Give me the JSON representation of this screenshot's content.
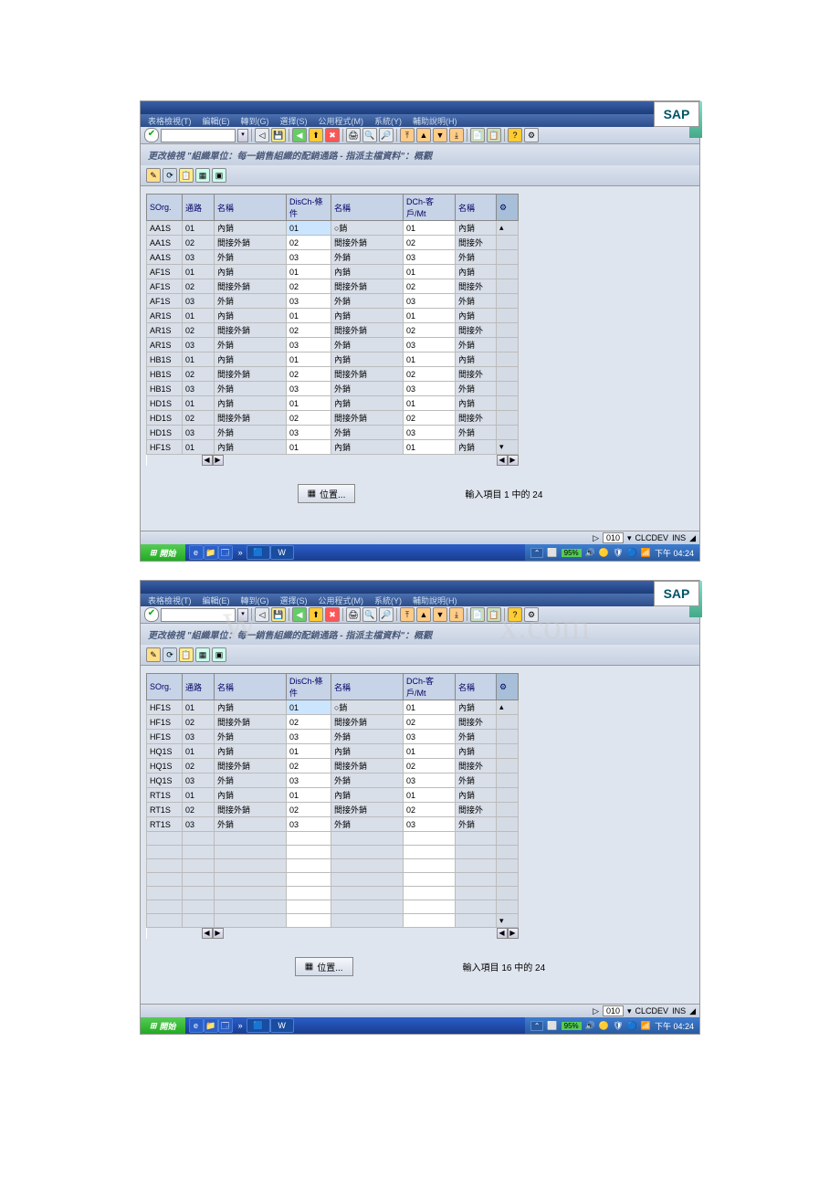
{
  "menu": [
    "表格檢視(T)",
    "編輯(E)",
    "轉到(G)",
    "選擇(S)",
    "公用程式(M)",
    "系統(Y)",
    "輔助說明(H)"
  ],
  "windowTitle": "更改檢視  \"組織單位：每一銷售組織的配銷通路  - 指派主檔資料\"：概觀",
  "positionBtn": "位置...",
  "pageInfo1": "輸入項目 1 中的 24",
  "pageInfo2": "輸入項目 16 中的 24",
  "status": {
    "client": "010",
    "sys": "CLCDEV",
    "mode": "INS"
  },
  "start": "開始",
  "tray": {
    "zoom": "95%",
    "time": "下午 04:24"
  },
  "sap": "SAP",
  "watermark1": "W",
  "watermark2": "x.com",
  "headers": [
    "SOrg.",
    "通路",
    "名稱",
    "DisCh-條件",
    "名稱",
    "DCh-客戶/Mt",
    "名稱"
  ],
  "rows1": [
    [
      "AA1S",
      "01",
      "內銷",
      "01",
      "○銷",
      "01",
      "內銷"
    ],
    [
      "AA1S",
      "02",
      "間接外銷",
      "02",
      "間接外銷",
      "02",
      "間接外"
    ],
    [
      "AA1S",
      "03",
      "外銷",
      "03",
      "外銷",
      "03",
      "外銷"
    ],
    [
      "AF1S",
      "01",
      "內銷",
      "01",
      "內銷",
      "01",
      "內銷"
    ],
    [
      "AF1S",
      "02",
      "間接外銷",
      "02",
      "間接外銷",
      "02",
      "間接外"
    ],
    [
      "AF1S",
      "03",
      "外銷",
      "03",
      "外銷",
      "03",
      "外銷"
    ],
    [
      "AR1S",
      "01",
      "內銷",
      "01",
      "內銷",
      "01",
      "內銷"
    ],
    [
      "AR1S",
      "02",
      "間接外銷",
      "02",
      "間接外銷",
      "02",
      "間接外"
    ],
    [
      "AR1S",
      "03",
      "外銷",
      "03",
      "外銷",
      "03",
      "外銷"
    ],
    [
      "HB1S",
      "01",
      "內銷",
      "01",
      "內銷",
      "01",
      "內銷"
    ],
    [
      "HB1S",
      "02",
      "間接外銷",
      "02",
      "間接外銷",
      "02",
      "間接外"
    ],
    [
      "HB1S",
      "03",
      "外銷",
      "03",
      "外銷",
      "03",
      "外銷"
    ],
    [
      "HD1S",
      "01",
      "內銷",
      "01",
      "內銷",
      "01",
      "內銷"
    ],
    [
      "HD1S",
      "02",
      "間接外銷",
      "02",
      "間接外銷",
      "02",
      "間接外"
    ],
    [
      "HD1S",
      "03",
      "外銷",
      "03",
      "外銷",
      "03",
      "外銷"
    ],
    [
      "HF1S",
      "01",
      "內銷",
      "01",
      "內銷",
      "01",
      "內銷"
    ]
  ],
  "rows2": [
    [
      "HF1S",
      "01",
      "內銷",
      "01",
      "○銷",
      "01",
      "內銷"
    ],
    [
      "HF1S",
      "02",
      "間接外銷",
      "02",
      "間接外銷",
      "02",
      "間接外"
    ],
    [
      "HF1S",
      "03",
      "外銷",
      "03",
      "外銷",
      "03",
      "外銷"
    ],
    [
      "HQ1S",
      "01",
      "內銷",
      "01",
      "內銷",
      "01",
      "內銷"
    ],
    [
      "HQ1S",
      "02",
      "間接外銷",
      "02",
      "間接外銷",
      "02",
      "間接外"
    ],
    [
      "HQ1S",
      "03",
      "外銷",
      "03",
      "外銷",
      "03",
      "外銷"
    ],
    [
      "RT1S",
      "01",
      "內銷",
      "01",
      "內銷",
      "01",
      "內銷"
    ],
    [
      "RT1S",
      "02",
      "間接外銷",
      "02",
      "間接外銷",
      "02",
      "間接外"
    ],
    [
      "RT1S",
      "03",
      "外銷",
      "03",
      "外銷",
      "03",
      "外銷"
    ]
  ]
}
